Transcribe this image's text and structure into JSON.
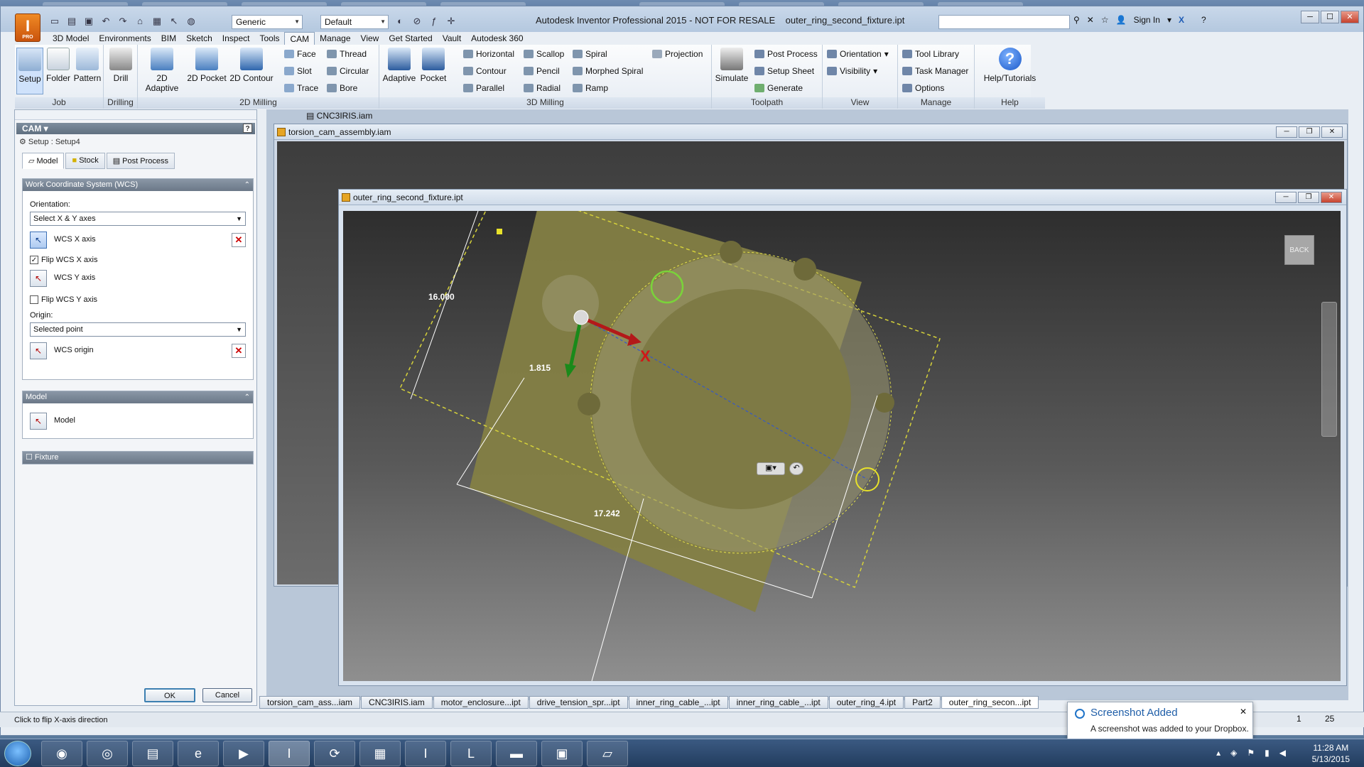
{
  "app": {
    "title": "Autodesk Inventor Professional 2015 - NOT FOR RESALE",
    "document": "outer_ring_second_fixture.ipt",
    "logo_text": "I",
    "logo_sub": "PRO",
    "material_combo": "Generic",
    "appearance_combo": "Default",
    "sign_in": "Sign In"
  },
  "menu_tabs": [
    "3D Model",
    "Environments",
    "BIM",
    "Sketch",
    "Inspect",
    "Tools",
    "CAM",
    "Manage",
    "View",
    "Get Started",
    "Vault",
    "Autodesk 360"
  ],
  "ribbon": {
    "job": {
      "label": "Job",
      "setup": "Setup",
      "folder": "Folder",
      "pattern": "Pattern"
    },
    "drilling": {
      "label": "Drilling",
      "drill": "Drill"
    },
    "milling2d": {
      "label": "2D Milling",
      "adaptive": "2D Adaptive",
      "pocket": "2D Pocket",
      "contour": "2D Contour",
      "face": "Face",
      "slot": "Slot",
      "trace": "Trace",
      "thread": "Thread",
      "circular": "Circular",
      "bore": "Bore"
    },
    "milling3d": {
      "label": "3D Milling",
      "adaptive": "Adaptive",
      "pocket": "Pocket",
      "horizontal": "Horizontal",
      "contour": "Contour",
      "parallel": "Parallel",
      "scallop": "Scallop",
      "pencil": "Pencil",
      "radial": "Radial",
      "spiral": "Spiral",
      "morphed_spiral": "Morphed Spiral",
      "ramp": "Ramp",
      "projection": "Projection"
    },
    "toolpath": {
      "label": "Toolpath",
      "simulate": "Simulate",
      "post_process": "Post Process",
      "setup_sheet": "Setup Sheet",
      "generate": "Generate"
    },
    "view": {
      "label": "View",
      "orientation": "Orientation",
      "visibility": "Visibility"
    },
    "manage": {
      "label": "Manage",
      "tool_library": "Tool Library",
      "task_manager": "Task Manager",
      "options": "Options"
    },
    "help": {
      "label": "Help",
      "tutorials": "Help/Tutorials"
    }
  },
  "panel": {
    "header": "CAM",
    "setup_title": "Setup : Setup4",
    "tabs": [
      "Model",
      "Stock",
      "Post Process"
    ],
    "wcs_header": "Work Coordinate System (WCS)",
    "orientation_label": "Orientation:",
    "orientation_value": "Select X & Y axes",
    "wcs_x_axis": "WCS X axis",
    "flip_x": "Flip WCS X axis",
    "flip_x_checked": true,
    "wcs_y_axis": "WCS Y axis",
    "flip_y": "Flip WCS Y axis",
    "flip_y_checked": false,
    "origin_label": "Origin:",
    "origin_value": "Selected point",
    "wcs_origin": "WCS origin",
    "model_header": "Model",
    "model_item": "Model",
    "fixture_header": "Fixture",
    "ok": "OK",
    "cancel": "Cancel"
  },
  "windows": {
    "background_doc": "CNC3IRIS.iam",
    "assembly": "torsion_cam_assembly.iam",
    "part": "outer_ring_second_fixture.ipt"
  },
  "viewport": {
    "dim1": "16.000",
    "dim2": "1.815",
    "dim3": "17.242",
    "axis_x": "X",
    "viewcube_back": "BACK"
  },
  "doc_tabs": [
    "torsion_cam_ass...iam",
    "CNC3IRIS.iam",
    "motor_enclosure...ipt",
    "drive_tension_spr...ipt",
    "inner_ring_cable_...ipt",
    "inner_ring_cable_...ipt",
    "outer_ring_4.ipt",
    "Part2",
    "outer_ring_secon...ipt"
  ],
  "status": {
    "text": "Click to flip X-axis direction",
    "page1": "1",
    "page2": "25"
  },
  "toast": {
    "title": "Screenshot Added",
    "message": "A screenshot was added to your Dropbox."
  },
  "clock": {
    "time": "11:28 AM",
    "date": "5/13/2015"
  },
  "colors": {
    "accent": "#f08a24",
    "part_fill": "#8a8745",
    "highlight_green": "#7ad33a",
    "highlight_yellow": "#e8e22a",
    "axis_x": "#b31919",
    "axis_y": "#1a8a1a"
  }
}
